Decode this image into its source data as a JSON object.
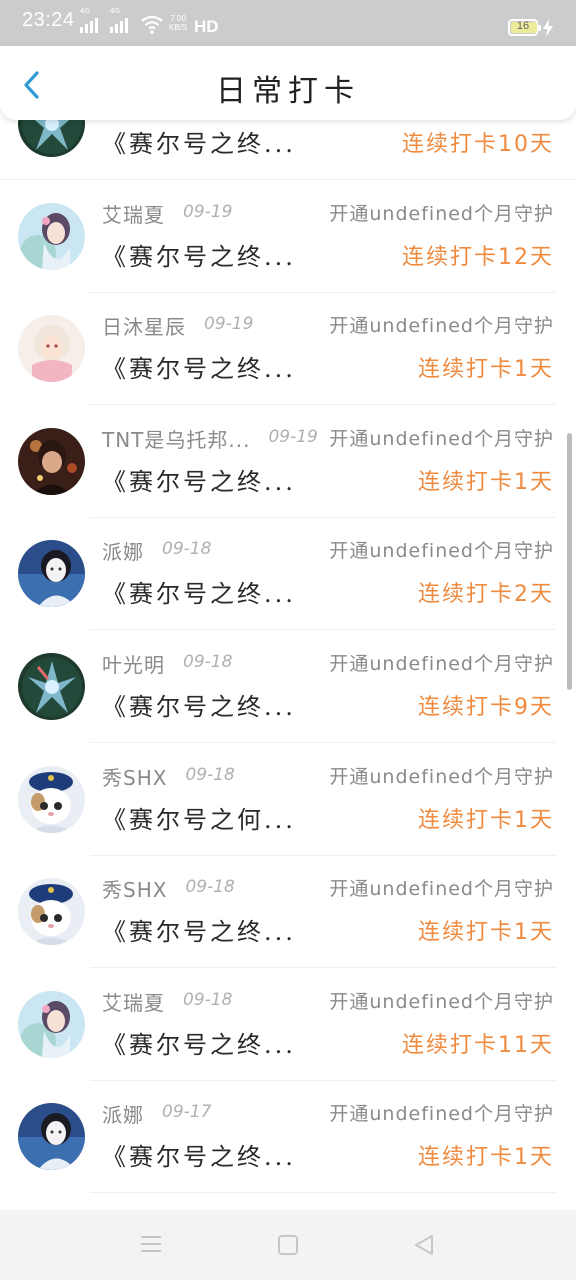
{
  "status_bar": {
    "time": "23:24",
    "net1": "4G",
    "net2": "4G",
    "speed_value": "7.00",
    "speed_unit": "KB/S",
    "hd": "HD",
    "battery": "16",
    "icons": [
      "signal-icon",
      "signal-icon",
      "wifi-icon",
      "battery-icon",
      "charging-icon"
    ]
  },
  "header": {
    "title": "日常打卡",
    "back_icon": "chevron-left-icon",
    "accent": "#2f9bd6"
  },
  "colors": {
    "streak": "#ef8a3e",
    "muted": "#8a8a8a",
    "date": "#b0b0b0"
  },
  "records": [
    {
      "name": "",
      "date": "",
      "open_text": "",
      "book": "《赛尔号之终...",
      "streak": "连续打卡10天",
      "avatar": "mecha"
    },
    {
      "name": "艾瑞夏",
      "date": "09-19",
      "open_text": "开通undefined个月守护",
      "book": "《赛尔号之终...",
      "streak": "连续打卡12天",
      "avatar": "anime-girl"
    },
    {
      "name": "日沐星辰",
      "date": "09-19",
      "open_text": "开通undefined个月守护",
      "book": "《赛尔号之终...",
      "streak": "连续打卡1天",
      "avatar": "cat-girl"
    },
    {
      "name": "TNT是乌托邦...",
      "date": "09-19",
      "open_text": "开通undefined个月守护",
      "book": "《赛尔号之终...",
      "streak": "连续打卡1天",
      "avatar": "boy"
    },
    {
      "name": "派娜",
      "date": "09-18",
      "open_text": "开通undefined个月守护",
      "book": "《赛尔号之终...",
      "streak": "连续打卡2天",
      "avatar": "girl-sea"
    },
    {
      "name": "叶光明",
      "date": "09-18",
      "open_text": "开通undefined个月守护",
      "book": "《赛尔号之终...",
      "streak": "连续打卡9天",
      "avatar": "mecha"
    },
    {
      "name": "秀SHX",
      "date": "09-18",
      "open_text": "开通undefined个月守护",
      "book": "《赛尔号之何...",
      "streak": "连续打卡1天",
      "avatar": "cat"
    },
    {
      "name": "秀SHX",
      "date": "09-18",
      "open_text": "开通undefined个月守护",
      "book": "《赛尔号之终...",
      "streak": "连续打卡1天",
      "avatar": "cat"
    },
    {
      "name": "艾瑞夏",
      "date": "09-18",
      "open_text": "开通undefined个月守护",
      "book": "《赛尔号之终...",
      "streak": "连续打卡11天",
      "avatar": "anime-girl"
    },
    {
      "name": "派娜",
      "date": "09-17",
      "open_text": "开通undefined个月守护",
      "book": "《赛尔号之终...",
      "streak": "连续打卡1天",
      "avatar": "girl-sea"
    }
  ],
  "nav_bar": {
    "icons": [
      "menu-icon",
      "home-square-icon",
      "back-triangle-icon"
    ]
  }
}
